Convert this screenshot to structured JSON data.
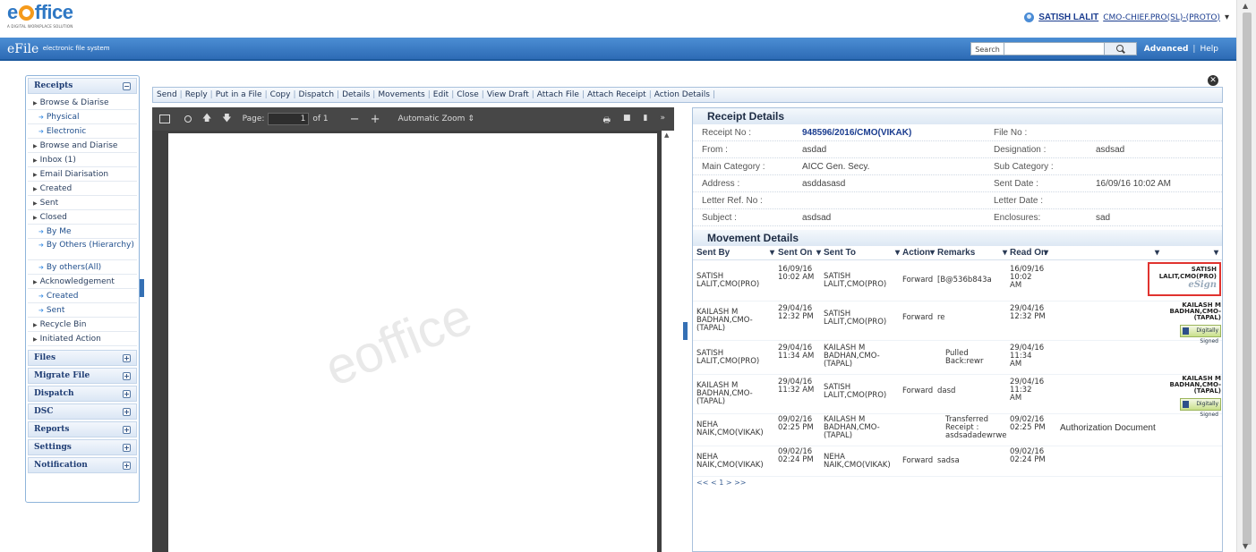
{
  "header": {
    "logo_text_prefix": "e",
    "logo_text_suffix": "ffice",
    "logo_tagline": "A DIGITAL WORKPLACE SOLUTION",
    "user_name": "SATISH LALIT",
    "user_role": "CMO-CHIEF.PRO(SL)-(PROTO)",
    "user_dropdown": "▾"
  },
  "banner": {
    "app_name": "eFile",
    "app_sub": "electronic file system",
    "search_label": "Search",
    "advanced": "Advanced",
    "separator": "|",
    "help": "Help"
  },
  "nav": {
    "receipts_title": "Receipts",
    "collapse": "−",
    "expand": "+",
    "items": [
      {
        "label": "Browse & Diarise"
      },
      {
        "label": "Physical"
      },
      {
        "label": "Electronic"
      },
      {
        "label": "Browse and Diarise"
      },
      {
        "label": "Inbox (1)"
      },
      {
        "label": "Email Diarisation"
      },
      {
        "label": "Created"
      },
      {
        "label": "Sent"
      },
      {
        "label": "Closed"
      },
      {
        "label": "By Me"
      },
      {
        "label": "By Others (Hierarchy)"
      },
      {
        "label": "By others(All)"
      },
      {
        "label": "Acknowledgement"
      },
      {
        "label": "Created"
      },
      {
        "label": "Sent"
      },
      {
        "label": "Recycle Bin"
      },
      {
        "label": "Initiated Action"
      }
    ],
    "sections": [
      "Files",
      "Migrate File",
      "Dispatch",
      "DSC",
      "Reports",
      "Settings",
      "Notification"
    ]
  },
  "toolbar": {
    "actions": [
      "Send",
      "Reply",
      "Put in a File",
      "Copy",
      "Dispatch",
      "Details",
      "Movements",
      "Edit",
      "Close",
      "View Draft",
      "Attach File",
      "Attach Receipt",
      "Action Details"
    ],
    "separator": "|",
    "close_label": "✕"
  },
  "pdf": {
    "page_label": "Page:",
    "page_value": "1",
    "page_of": "of 1",
    "zoom": "Automatic Zoom",
    "zoom_out": "−",
    "zoom_in": "+",
    "more": "»",
    "watermark": "eoffice"
  },
  "receipt_details": {
    "title": "Receipt Details",
    "rows": [
      {
        "l1": "Receipt No :",
        "v1": "948596/2016/CMO(VIKAK)",
        "l2": "File No :",
        "v2": ""
      },
      {
        "l1": "From :",
        "v1": "asdad",
        "l2": "Designation :",
        "v2": "asdsad"
      },
      {
        "l1": "Main Category :",
        "v1": "AICC Gen. Secy.",
        "l2": "Sub Category :",
        "v2": ""
      },
      {
        "l1": "Address :",
        "v1": "asddasasd",
        "l2": "Sent Date :",
        "v2": "16/09/16 10:02 AM"
      },
      {
        "l1": "Letter Ref. No :",
        "v1": "",
        "l2": "Letter Date :",
        "v2": ""
      },
      {
        "l1": "Subject :",
        "v1": "asdsad",
        "l2": "Enclosures:",
        "v2": "sad"
      }
    ]
  },
  "movement_details": {
    "title": "Movement Details",
    "headers": [
      "Sent By",
      "Sent On",
      "Sent To",
      "Action",
      "Remarks",
      "Read On"
    ],
    "sort_icon": "▾",
    "rows": [
      {
        "sent_by": "SATISH LALIT,CMO(PRO)",
        "sent_on": "16/09/16 10:02 AM",
        "sent_to": "SATISH LALIT,CMO(PRO)",
        "action": "Forward",
        "remarks": "[B@536b843a",
        "read_on": "16/09/16 10:02 AM",
        "sign": "SATISH LALIT,CMO(PRO)",
        "sign_script": "eSign",
        "badge": ""
      },
      {
        "sent_by": "KAILASH M BADHAN,CMO-(TAPAL)",
        "sent_on": "29/04/16 12:32 PM",
        "sent_to": "SATISH LALIT,CMO(PRO)",
        "action": "Forward",
        "remarks": "re",
        "read_on": "29/04/16 12:32 PM",
        "sign": "KAILASH M BADHAN,CMO-(TAPAL)",
        "sign_script": "",
        "badge": "Digitally Signed"
      },
      {
        "sent_by": "SATISH LALIT,CMO(PRO)",
        "sent_on": "29/04/16 11:34 AM",
        "sent_to": "KAILASH M BADHAN,CMO-(TAPAL)",
        "action": "",
        "remarks": "Pulled Back:rewr",
        "read_on": "29/04/16 11:34 AM",
        "sign": "",
        "sign_script": "",
        "badge": ""
      },
      {
        "sent_by": "KAILASH M BADHAN,CMO-(TAPAL)",
        "sent_on": "29/04/16 11:32 AM",
        "sent_to": "SATISH LALIT,CMO(PRO)",
        "action": "Forward",
        "remarks": "dasd",
        "read_on": "29/04/16 11:32 AM",
        "sign": "KAILASH M BADHAN,CMO-(TAPAL)",
        "sign_script": "",
        "badge": "Digitally Signed"
      },
      {
        "sent_by": "NEHA NAIK,CMO(VIKAK)",
        "sent_on": "09/02/16 02:25 PM",
        "sent_to": "KAILASH M BADHAN,CMO-(TAPAL)",
        "action": "",
        "remarks": "Transferred Receipt : asdsadadewrwe",
        "read_on": "09/02/16 02:25 PM",
        "sign": "",
        "sign_script": "",
        "badge": "",
        "note": "Authorization Document"
      },
      {
        "sent_by": "NEHA NAIK,CMO(VIKAK)",
        "sent_on": "09/02/16 02:24 PM",
        "sent_to": "NEHA NAIK,CMO(VIKAK)",
        "action": "Forward",
        "remarks": "sadsa",
        "read_on": "09/02/16 02:24 PM",
        "sign": "",
        "sign_script": "",
        "badge": ""
      }
    ],
    "pager": "<< < 1 > >>"
  }
}
